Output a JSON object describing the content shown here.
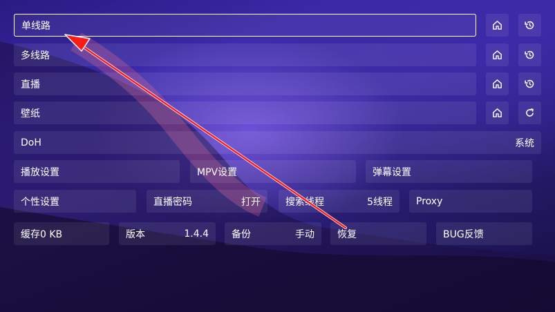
{
  "lines": [
    {
      "label": "单线路"
    },
    {
      "label": "多线路"
    },
    {
      "label": "直播"
    },
    {
      "label": "壁纸"
    }
  ],
  "doh": {
    "label": "DoH",
    "value": "系统"
  },
  "settings_row": {
    "play": "播放设置",
    "mpv": "MPV设置",
    "danmaku": "弹幕设置"
  },
  "row4": {
    "personal": "个性设置",
    "live_pwd_label": "直播密码",
    "live_pwd_value": "打开",
    "search_thread_label": "搜索线程",
    "search_thread_value": "5线程",
    "proxy": "Proxy"
  },
  "row5": {
    "cache": "缓存0 KB",
    "version_label": "版本",
    "version_value": "1.4.4",
    "backup_label": "备份",
    "backup_value": "手动",
    "restore": "恢复",
    "bug": "BUG反馈"
  },
  "icons": {
    "home": "home-icon",
    "history": "history-icon",
    "refresh": "refresh-icon"
  },
  "colors": {
    "arrow": "#ff1a1a",
    "accent_border": "#ffffff"
  }
}
